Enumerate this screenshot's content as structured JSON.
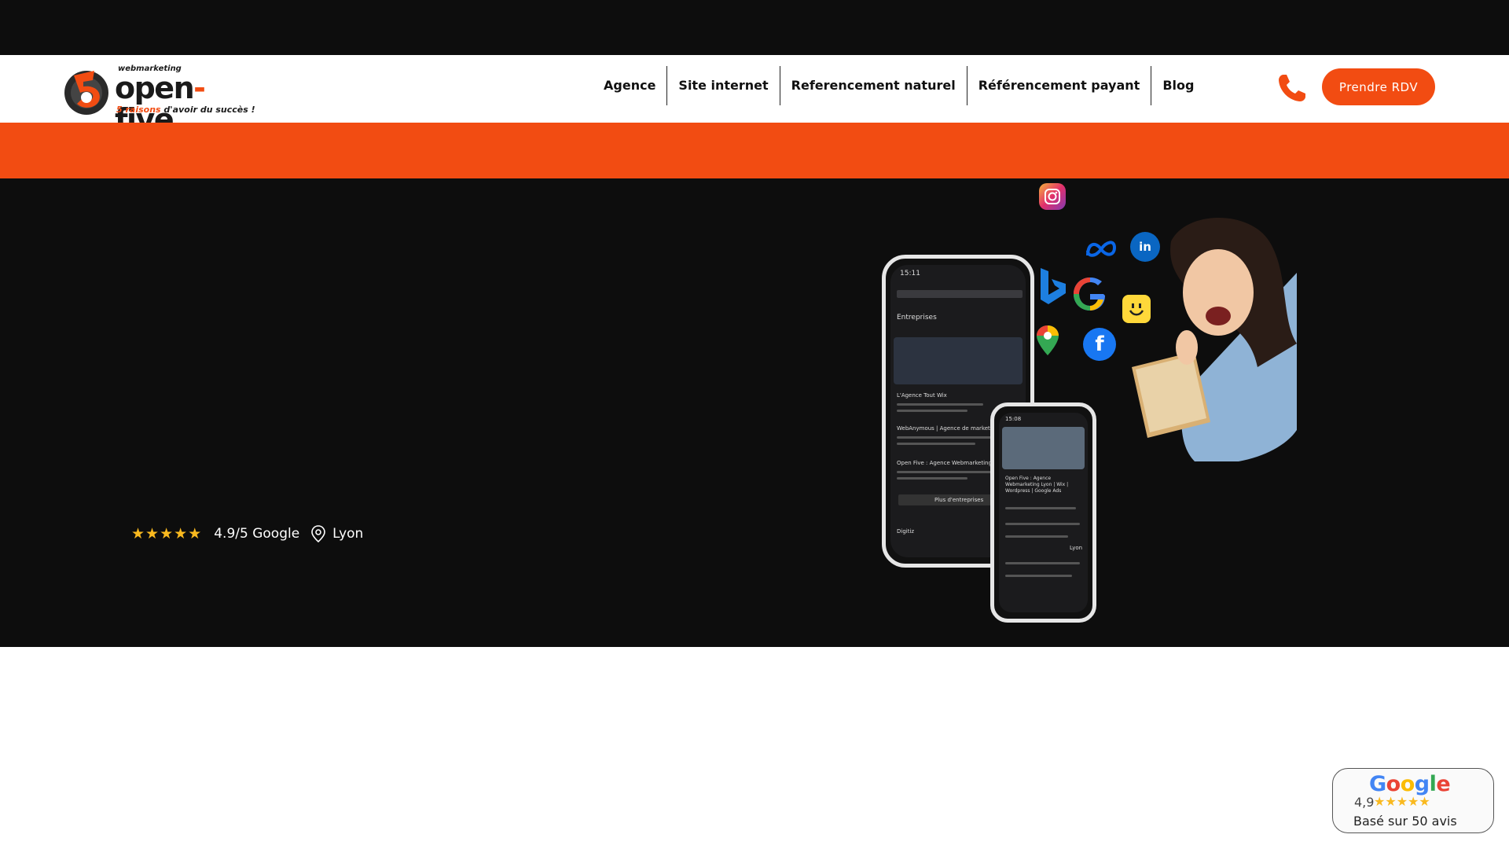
{
  "header": {
    "logo": {
      "superscript": "webmarketing",
      "word_part1": "open",
      "word_dash": "-",
      "word_part2": "five",
      "tagline_accent": "5 raisons",
      "tagline_rest": " d'avoir du succès !"
    },
    "nav": [
      {
        "label": "Agence"
      },
      {
        "label": "Site internet"
      },
      {
        "label": "Referencement naturel"
      },
      {
        "label": "Référencement payant"
      },
      {
        "label": "Blog"
      }
    ],
    "phone_icon": "phone-icon",
    "cta_label": "Prendre RDV"
  },
  "hero": {
    "rating_text": "4.9/5 Google",
    "location_text": "Lyon",
    "stars_count": 5,
    "phone_a": {
      "time": "15:11",
      "section": "Entreprises",
      "listing1": "L'Agence Tout Wix",
      "listing2": "WebAnymous | Agence de marketing internet",
      "listing3": "Open Five : Agence Webmarketing Lyon | Wix",
      "more": "Plus d'entreprises",
      "footer": "Digitiz"
    },
    "phone_b": {
      "time": "15:08",
      "title": "Open Five : Agence Webmarketing Lyon | Wix | Wordpress | Google Ads",
      "city": "Lyon"
    },
    "social_icons": [
      "instagram-icon",
      "meta-icon",
      "linkedin-icon",
      "bing-icon",
      "google-icon",
      "smiley-icon",
      "maps-pin-icon",
      "facebook-icon"
    ]
  },
  "review_badge": {
    "brand": "Google",
    "score": "4,9",
    "count_text": "Basé sur 50 avis"
  },
  "colors": {
    "brand_orange": "#f24c12",
    "dark": "#0d0d0d",
    "star": "#f9b91f"
  }
}
